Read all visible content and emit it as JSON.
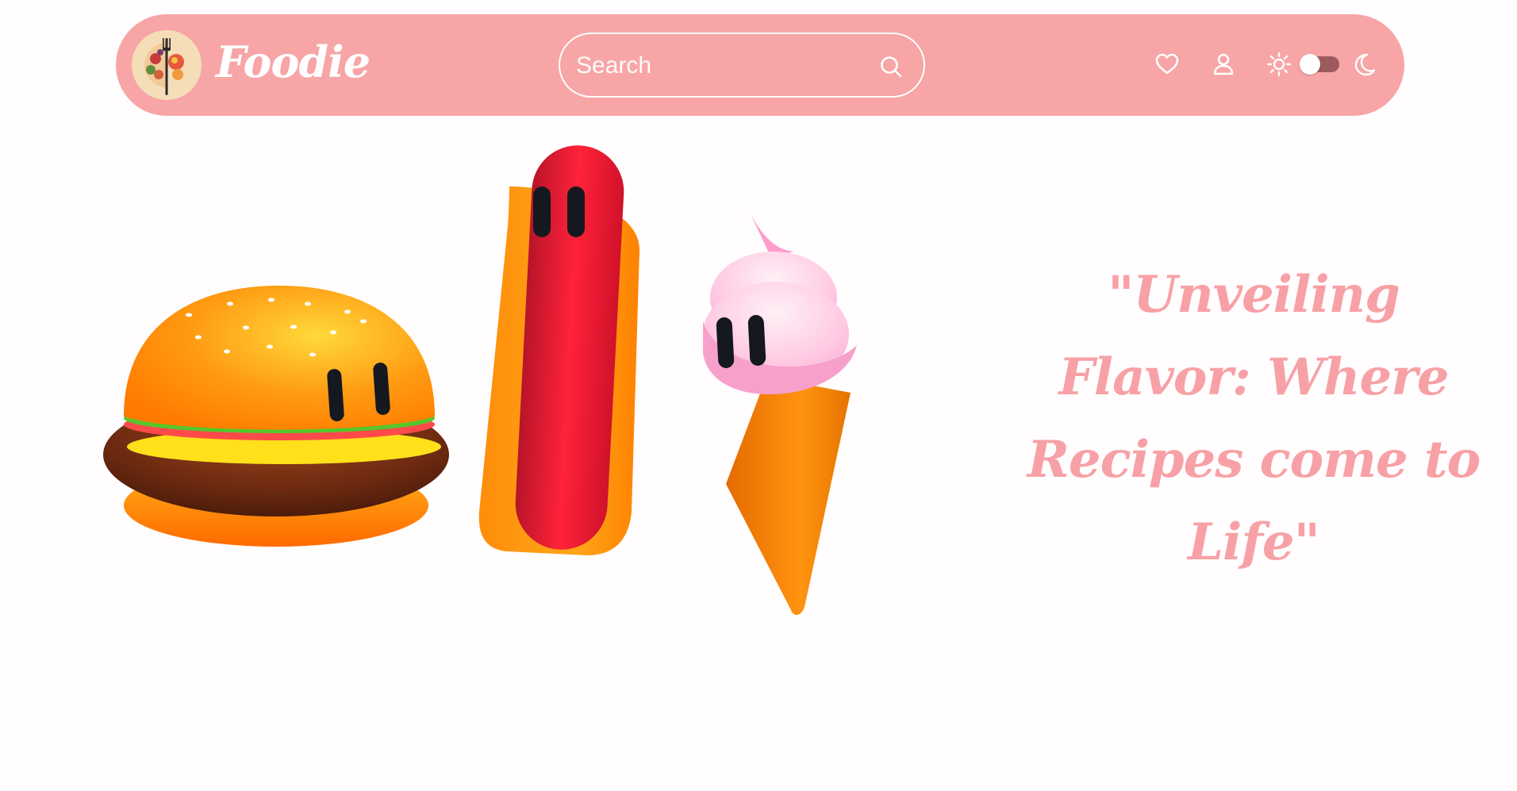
{
  "header": {
    "brand": "Foodie",
    "logo_icon": "food-plate-fork-icon"
  },
  "search": {
    "placeholder": "Search",
    "value": "",
    "icon": "search-icon"
  },
  "nav_icons": {
    "favorites": "heart-icon",
    "account": "user-icon",
    "light_mode": "sun-icon",
    "dark_mode": "moon-icon"
  },
  "theme_toggle": {
    "state": "light"
  },
  "hero": {
    "characters": [
      "burger",
      "hot-dog",
      "ice-cream-cone"
    ],
    "tagline": "\"Unveiling Flavor: Where Recipes come to Life\""
  },
  "colors": {
    "navbar": "#f7a5a6",
    "tagline": "#f7a1a6",
    "background": "#fffdfd",
    "toggle_track": "#9c5a5c"
  }
}
